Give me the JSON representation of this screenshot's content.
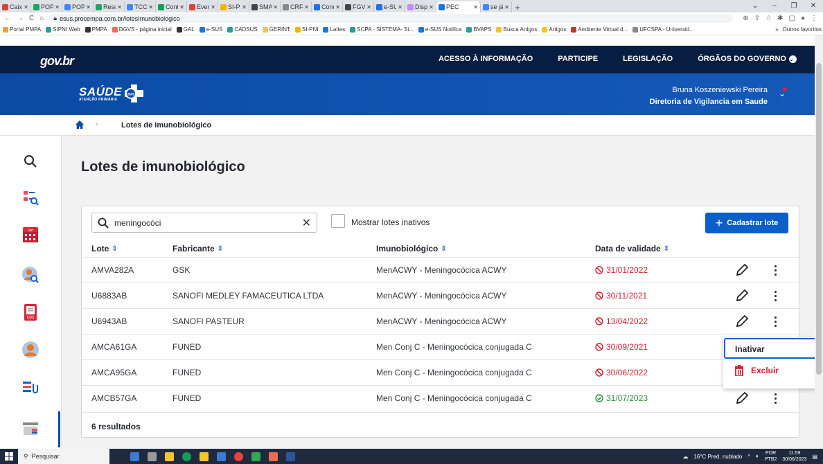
{
  "browser": {
    "tabs": [
      {
        "title": "Caixa d",
        "color": "#d44638"
      },
      {
        "title": "POP UF",
        "color": "#1fa463"
      },
      {
        "title": "POP-Im",
        "color": "#4285f4"
      },
      {
        "title": "Resulta",
        "color": "#1fa463"
      },
      {
        "title": "TCC NC",
        "color": "#4285f4"
      },
      {
        "title": "Contas",
        "color": "#0f9d58"
      },
      {
        "title": "Evento",
        "color": "#d44638"
      },
      {
        "title": "SI-PNI",
        "color": "#f4b400"
      },
      {
        "title": "SMAP_",
        "color": "#444"
      },
      {
        "title": "CRF-RS",
        "color": "#888"
      },
      {
        "title": "Concur",
        "color": "#1a73e8"
      },
      {
        "title": "FGV Cc",
        "color": "#444"
      },
      {
        "title": "e-SUS",
        "color": "#1a73e8"
      },
      {
        "title": "Dispen",
        "color": "#c58af9"
      },
      {
        "title": "PEC",
        "color": "#1a73e8",
        "active": true
      },
      {
        "title": "se já ti",
        "color": "#4285f4"
      }
    ],
    "new_tab": "+",
    "window_controls": [
      "⌄",
      "–",
      "❐",
      "✕"
    ],
    "url": "esus.procempa.com.br/lotesImunobiologico",
    "bookmarks": [
      {
        "label": "Portal PMPA",
        "color": "#e8a33d"
      },
      {
        "label": "SIPNI Web",
        "color": "#2a9d8f"
      },
      {
        "label": "PMPA",
        "color": "#333"
      },
      {
        "label": "DGVS - página inicial",
        "color": "#e76f51"
      },
      {
        "label": "GAL",
        "color": "#333"
      },
      {
        "label": "e-SUS",
        "color": "#1a73e8"
      },
      {
        "label": "CADSUS",
        "color": "#2a9d8f"
      },
      {
        "label": "GERINT",
        "color": "#e9c46a"
      },
      {
        "label": "SI-PNI",
        "color": "#f4b400"
      },
      {
        "label": "Lattes",
        "color": "#1a73e8"
      },
      {
        "label": "SCPA - SISTEMA- Si...",
        "color": "#2a9d8f"
      },
      {
        "label": "e-SUS Notifica",
        "color": "#1a73e8"
      },
      {
        "label": "BVAPS",
        "color": "#2a9d8f"
      },
      {
        "label": "Busca Artigos",
        "color": "#f4c430"
      },
      {
        "label": "Artigos",
        "color": "#f4c430"
      },
      {
        "label": "Ambiente Virtual d...",
        "color": "#c0392b"
      },
      {
        "label": "UFCSPA - Universid...",
        "color": "#888"
      }
    ],
    "bookmarks_more": "»",
    "other_bookmarks": "Outros favoritos"
  },
  "gov": {
    "logo": "gov.br",
    "nav": [
      "ACESSO À INFORMAÇÃO",
      "PARTICIPE",
      "LEGISLAÇÃO",
      "ÓRGÃOS DO GOVERNO"
    ]
  },
  "header": {
    "logo_title": "SAÚDE",
    "logo_subtitle": "ATENÇÃO PRIMÁRIA",
    "logo_badge": "sus",
    "user_name": "Bruna Koszeniewski Pereira",
    "user_unit": "Diretoria de Vigilancia em Saude"
  },
  "breadcrumb": {
    "separator": "›",
    "current": "Lotes de imunobiológico"
  },
  "page": {
    "title": "Lotes de imunobiológico",
    "search_value": "meningocóci",
    "show_inactive_label": "Mostrar lotes inativos",
    "add_button": "Cadastrar lote",
    "columns": [
      "Lote",
      "Fabricante",
      "Imunobiológico",
      "Data de validade"
    ],
    "rows": [
      {
        "lote": "AMVA282A",
        "fabricante": "GSK",
        "imuno": "MenACWY - Meningocócica ACWY",
        "validade": "31/01/2022",
        "status": "expired"
      },
      {
        "lote": "U6883AB",
        "fabricante": "SANOFI MEDLEY FAMACEUTICA LTDA",
        "imuno": "MenACWY - Meningocócica ACWY",
        "validade": "30/11/2021",
        "status": "expired"
      },
      {
        "lote": "U6943AB",
        "fabricante": "SANOFI PASTEUR",
        "imuno": "MenACWY - Meningocócica ACWY",
        "validade": "13/04/2022",
        "status": "expired"
      },
      {
        "lote": "AMCA61GA",
        "fabricante": "FUNED",
        "imuno": "Men Conj C - Meningocócica conjugada C",
        "validade": "30/09/2021",
        "status": "expired"
      },
      {
        "lote": "AMCA95GA",
        "fabricante": "FUNED",
        "imuno": "Men Conj C - Meningocócica conjugada C",
        "validade": "30/06/2022",
        "status": "expired"
      },
      {
        "lote": "AMCB57GA",
        "fabricante": "FUNED",
        "imuno": "Men Conj C - Meningocócica conjugada C",
        "validade": "31/07/2023",
        "status": "valid"
      }
    ],
    "results": "6 resultados",
    "menu": {
      "inativar": "Inativar",
      "excluir": "Excluir"
    }
  },
  "sidebar": {
    "calendar_month": "Jan",
    "cds_label": "CDS"
  },
  "taskbar": {
    "search": "Pesquisar",
    "weather": "16°C  Pred. nublado",
    "lang1": "POR",
    "lang2": "PTB2",
    "time": "11:59",
    "date": "30/06/2023"
  }
}
